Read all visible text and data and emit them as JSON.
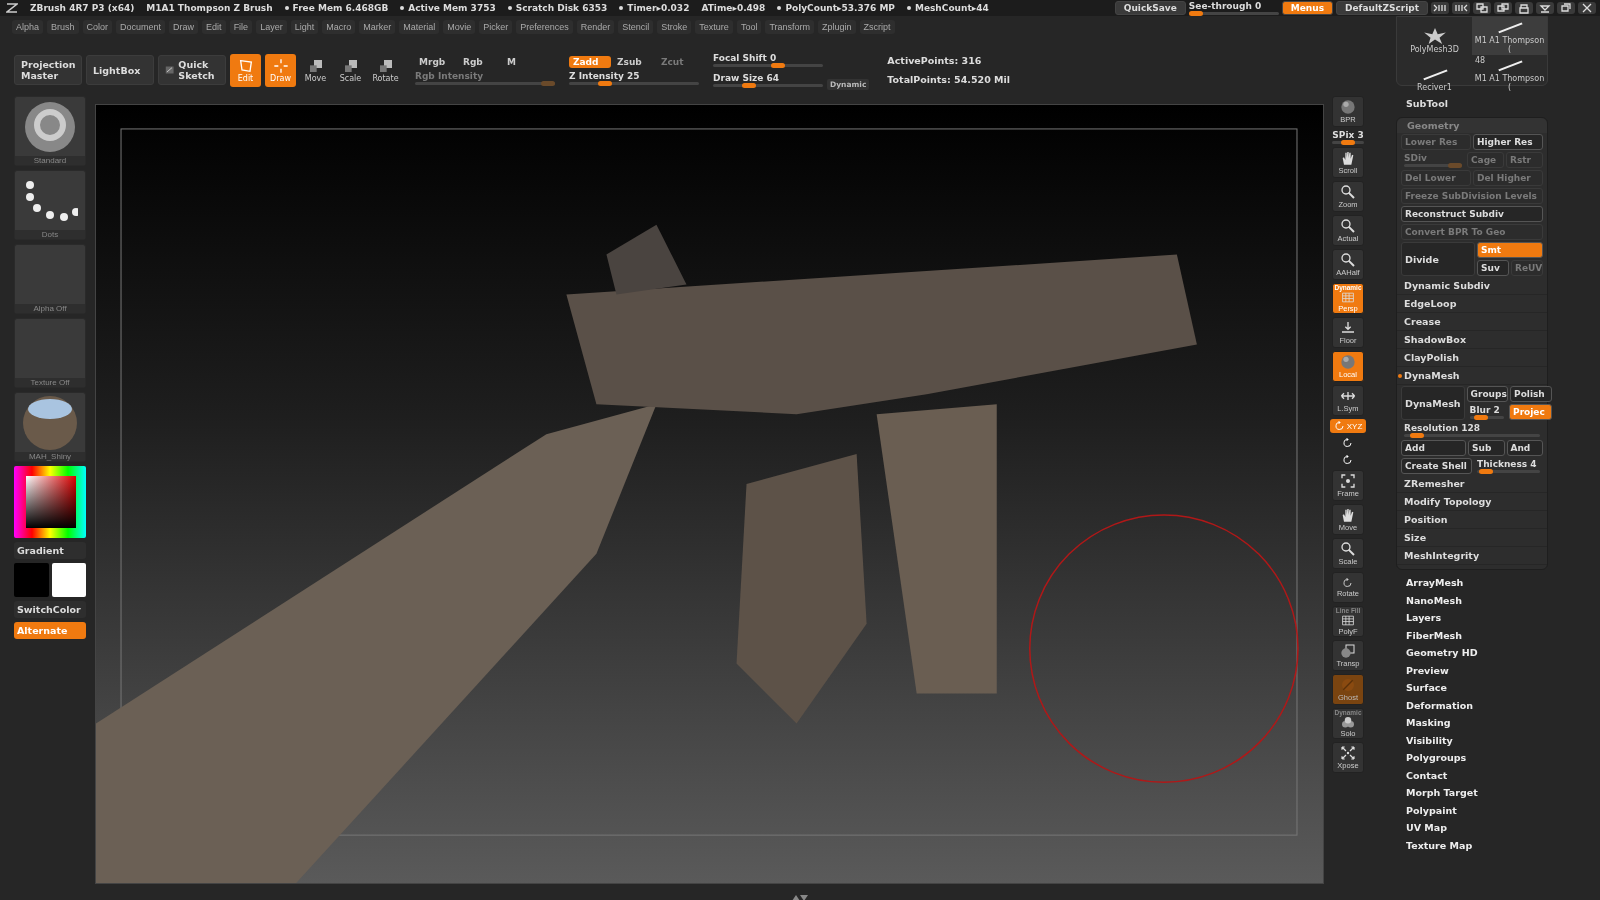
{
  "title_bar": {
    "app": "ZBrush 4R7 P3 (x64)",
    "document": "M1A1 Thompson Z Brush",
    "stats": [
      {
        "text": "Free Mem 6.468GB",
        "dot": true
      },
      {
        "text": "Active Mem 3753",
        "dot": true
      },
      {
        "text": "Scratch Disk 6353",
        "dot": true
      },
      {
        "text": "Timer▸0.032",
        "dot": true
      },
      {
        "text": "ATime▸0.498",
        "dot": false
      },
      {
        "text": "PolyCount▸53.376 MP",
        "dot": true
      },
      {
        "text": "MeshCount▸44",
        "dot": true
      }
    ],
    "quicksave": "QuickSave",
    "see_through": {
      "label": "See-through 0",
      "level": 0
    },
    "menus": {
      "label": "Menus",
      "on": true
    },
    "script": "DefaultZScript"
  },
  "menu_bar": [
    "Alpha",
    "Brush",
    "Color",
    "Document",
    "Draw",
    "Edit",
    "File",
    "Layer",
    "Light",
    "Macro",
    "Marker",
    "Material",
    "Movie",
    "Picker",
    "Preferences",
    "Render",
    "Stencil",
    "Stroke",
    "Texture",
    "Tool",
    "Transform",
    "Zplugin",
    "Zscript"
  ],
  "tool_thumbs": [
    {
      "label": "PolyMesh3D",
      "kind": "star",
      "selected": false
    },
    {
      "label": "M1 A1  Thompson (",
      "kind": "blade",
      "selected": true
    },
    {
      "label": "Reciver1",
      "kind": "blade",
      "selected": false
    },
    {
      "label": "M1 A1  Thompson (",
      "kind": "blade",
      "selected": false,
      "count": "48"
    }
  ],
  "toolbar": {
    "big_buttons": [
      {
        "label": "Projection Master"
      },
      {
        "label": "LightBox"
      },
      {
        "label": "Quick Sketch"
      }
    ],
    "modes": [
      {
        "label": "Edit",
        "kind": "edit",
        "on": true
      },
      {
        "label": "Draw",
        "kind": "draw",
        "on": true
      },
      {
        "label": "Move",
        "kind": "cube",
        "on": false
      },
      {
        "label": "Scale",
        "kind": "cube",
        "on": false
      },
      {
        "label": "Rotate",
        "kind": "cube",
        "on": false
      }
    ],
    "color_modes": [
      {
        "label": "Mrgb",
        "on": false
      },
      {
        "label": "Rgb",
        "on": false
      },
      {
        "label": "M",
        "on": false
      }
    ],
    "rgb_intensity": {
      "label": "Rgb Intensity",
      "disabled": true,
      "level": 1
    },
    "z_modes": [
      {
        "label": "Zadd",
        "on": true,
        "disabled": false
      },
      {
        "label": "Zsub",
        "on": false,
        "disabled": false
      },
      {
        "label": "Zcut",
        "on": false,
        "disabled": true
      }
    ],
    "z_intensity": {
      "label": "Z Intensity 25",
      "level": 0.25
    },
    "focal_shift": {
      "label": "Focal Shift 0",
      "level": 0.6
    },
    "draw_size": {
      "label": "Draw Size 64",
      "level": 0.3
    },
    "dynamic": "Dynamic",
    "active_points": "ActivePoints: 316",
    "total_points": "TotalPoints: 54.520 Mil"
  },
  "left_shelf": {
    "slots": [
      {
        "label": "Standard",
        "kind": "brush"
      },
      {
        "label": "Dots",
        "kind": "stroke"
      },
      {
        "label": "Alpha  Off",
        "kind": "empty"
      },
      {
        "label": "Texture  Off",
        "kind": "empty"
      },
      {
        "label": "MAH_Shiny",
        "kind": "material"
      }
    ],
    "gradient": "Gradient",
    "switch_color": "SwitchColor",
    "alternate": {
      "label": "Alternate",
      "on": true
    }
  },
  "right_tools": [
    {
      "label": "BPR",
      "kind": "sphere",
      "on": false,
      "disabled": false
    },
    {
      "kind": "slider",
      "label": "SPix 3",
      "level": 0.5
    },
    {
      "label": "Scroll",
      "kind": "hand",
      "on": false,
      "disabled": false
    },
    {
      "label": "Zoom",
      "kind": "magnifier",
      "on": false,
      "disabled": false
    },
    {
      "label": "Actual",
      "kind": "magnifier",
      "on": false,
      "disabled": false
    },
    {
      "label": "AAHalf",
      "kind": "magnifier",
      "on": false,
      "disabled": false
    },
    {
      "label": "Persp",
      "kind": "grid",
      "caption": "Dynamic",
      "on": true,
      "disabled": false
    },
    {
      "label": "Floor",
      "kind": "floor",
      "on": false,
      "disabled": false
    },
    {
      "label": "Local",
      "kind": "sphere",
      "on": true,
      "disabled": false
    },
    {
      "label": "L.Sym",
      "kind": "arrows",
      "on": false,
      "disabled": false
    },
    {
      "label": "XYZ",
      "kind": "axis",
      "on": true,
      "disabled": false
    },
    {
      "kind": "axis",
      "on": false,
      "disabled": false
    },
    {
      "kind": "axis",
      "on": false,
      "disabled": false
    },
    {
      "label": "Frame",
      "kind": "corners",
      "on": false,
      "disabled": false
    },
    {
      "label": "Move",
      "kind": "hand",
      "on": false,
      "disabled": false
    },
    {
      "label": "Scale",
      "kind": "magnifier",
      "on": false,
      "disabled": false
    },
    {
      "label": "Rotate",
      "kind": "rotate",
      "on": false,
      "disabled": false
    },
    {
      "label": "PolyF",
      "kind": "grid",
      "caption": "Line Fill",
      "on": false,
      "disabled": false
    },
    {
      "label": "Transp",
      "kind": "squares",
      "on": false,
      "disabled": false
    },
    {
      "label": "Ghost",
      "kind": "ghost",
      "on": true,
      "disabled": true
    },
    {
      "label": "Solo",
      "kind": "spheres",
      "caption": "Dynamic",
      "on": false,
      "disabled": false
    },
    {
      "label": "Xpose",
      "kind": "xpose",
      "on": false,
      "disabled": false
    }
  ],
  "subtool": {
    "label": "SubTool"
  },
  "geometry": {
    "title": "Geometry",
    "rows": [
      {
        "kind": "buttons",
        "items": [
          {
            "kind": "button",
            "label": "Lower Res",
            "on": false,
            "disabled": true
          },
          {
            "kind": "button",
            "label": "Higher Res",
            "on": false,
            "disabled": false
          }
        ]
      },
      {
        "kind": "buttons",
        "items": [
          {
            "kind": "slider",
            "label": "SDiv",
            "disabled": true,
            "level": 1
          },
          {
            "kind": "button",
            "label": "Cage",
            "on": false,
            "disabled": true
          },
          {
            "kind": "button",
            "label": "Rstr",
            "on": false,
            "disabled": true
          }
        ]
      },
      {
        "kind": "buttons",
        "items": [
          {
            "kind": "button",
            "label": "Del Lower",
            "on": false,
            "disabled": true
          },
          {
            "kind": "button",
            "label": "Del Higher",
            "on": false,
            "disabled": true
          }
        ]
      },
      {
        "kind": "buttons",
        "items": [
          {
            "kind": "button",
            "label": "Freeze SubDivision Levels",
            "on": false,
            "disabled": true
          }
        ]
      },
      {
        "kind": "buttons",
        "items": [
          {
            "kind": "button",
            "label": "Reconstruct Subdiv",
            "on": false,
            "disabled": false
          }
        ]
      },
      {
        "kind": "buttons",
        "items": [
          {
            "kind": "button",
            "label": "Convert BPR To Geo",
            "on": false,
            "disabled": true
          }
        ]
      },
      {
        "kind": "split",
        "left": {
          "label": "Divide"
        },
        "rows": [
          [
            {
              "kind": "button",
              "label": "Smt",
              "on": true,
              "disabled": false
            }
          ],
          [
            {
              "kind": "button",
              "label": "Suv",
              "on": false,
              "disabled": false
            },
            {
              "kind": "button",
              "label": "ReUV",
              "on": false,
              "disabled": true
            }
          ]
        ]
      },
      {
        "kind": "section",
        "label": "Dynamic Subdiv",
        "expanded": false
      },
      {
        "kind": "section",
        "label": "EdgeLoop",
        "expanded": false
      },
      {
        "kind": "section",
        "label": "Crease",
        "expanded": false
      },
      {
        "kind": "section",
        "label": "ShadowBox",
        "expanded": false
      },
      {
        "kind": "section",
        "label": "ClayPolish",
        "expanded": false
      },
      {
        "kind": "section",
        "label": "DynaMesh",
        "expanded": true
      },
      {
        "kind": "split",
        "left": {
          "label": "DynaMesh"
        },
        "rows": [
          [
            {
              "kind": "button",
              "label": "Groups",
              "on": false,
              "disabled": false
            },
            {
              "kind": "button",
              "label": "Polish",
              "on": false,
              "disabled": false
            }
          ],
          [
            {
              "kind": "slider",
              "label": "Blur 2",
              "disabled": false,
              "level": 0.2
            },
            {
              "kind": "button",
              "label": "Projec",
              "on": true,
              "disabled": false
            }
          ]
        ]
      },
      {
        "kind": "buttons",
        "items": [
          {
            "kind": "slider",
            "label": "Resolution 128",
            "disabled": false,
            "level": 0.05
          }
        ]
      },
      {
        "kind": "buttons",
        "items": [
          {
            "kind": "button",
            "label": "Add",
            "on": false,
            "disabled": false
          },
          {
            "kind": "button",
            "label": "Sub",
            "on": false,
            "disabled": false
          },
          {
            "kind": "button",
            "label": "And",
            "on": false,
            "disabled": false
          }
        ]
      },
      {
        "kind": "buttons",
        "items": [
          {
            "kind": "button",
            "label": "Create Shell",
            "on": false,
            "disabled": false
          },
          {
            "kind": "slider",
            "label": "Thickness 4",
            "disabled": false,
            "level": 0.05
          }
        ]
      },
      {
        "kind": "section",
        "label": "ZRemesher",
        "expanded": false
      },
      {
        "kind": "section",
        "label": "Modify Topology",
        "expanded": false
      },
      {
        "kind": "section",
        "label": "Position",
        "expanded": false
      },
      {
        "kind": "section",
        "label": "Size",
        "expanded": false
      },
      {
        "kind": "section",
        "label": "MeshIntegrity",
        "expanded": false
      }
    ]
  },
  "subpalettes": [
    "ArrayMesh",
    "NanoMesh",
    "Layers",
    "FiberMesh",
    "Geometry HD",
    "Preview",
    "Surface",
    "Deformation",
    "Masking",
    "Visibility",
    "Polygroups",
    "Contact",
    "Morph Target",
    "Polypaint",
    "UV Map",
    "Texture Map"
  ]
}
